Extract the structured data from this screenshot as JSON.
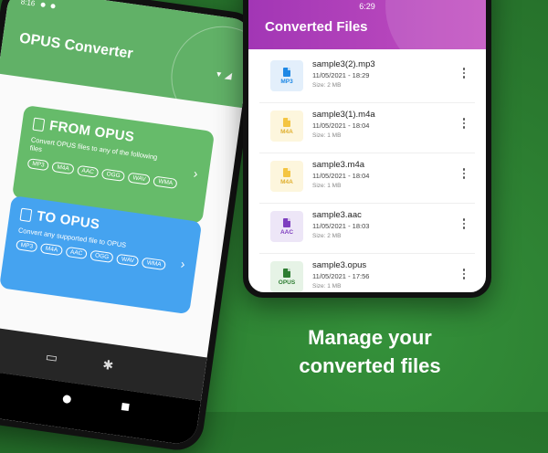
{
  "left_phone": {
    "status_time": "8:16",
    "app_title": "OPUS Converter",
    "from_card": {
      "title": "FROM OPUS",
      "description": "Convert OPUS files to any of the following files",
      "formats": [
        "MP3",
        "M4A",
        "AAC",
        "OGG",
        "WAV",
        "WMA"
      ]
    },
    "to_card": {
      "title": "TO OPUS",
      "description": "Convert any supported file to OPUS",
      "formats": [
        "MP3",
        "M4A",
        "AAC",
        "OGG",
        "WAV",
        "WMA"
      ]
    }
  },
  "right_phone": {
    "status_time": "6:29",
    "screen_title": "Converted Files",
    "files": [
      {
        "name": "sample3(2).mp3",
        "date": "11/05/2021 - 18:29",
        "size": "Size: 2 MB",
        "ext": "MP3",
        "icon_bg": "#e3effb",
        "icon_color": "#1e88e5"
      },
      {
        "name": "sample3(1).m4a",
        "date": "11/05/2021 - 18:04",
        "size": "Size: 1 MB",
        "ext": "M4A",
        "icon_bg": "#fdf6dd",
        "icon_color": "#f4c542"
      },
      {
        "name": "sample3.m4a",
        "date": "11/05/2021 - 18:04",
        "size": "Size: 1 MB",
        "ext": "M4A",
        "icon_bg": "#fdf6dd",
        "icon_color": "#f4c542"
      },
      {
        "name": "sample3.aac",
        "date": "11/05/2021 - 18:03",
        "size": "Size: 2 MB",
        "ext": "AAC",
        "icon_bg": "#ede6f7",
        "icon_color": "#7e3fbf"
      },
      {
        "name": "sample3.opus",
        "date": "11/05/2021 - 17:56",
        "size": "Size: 1 MB",
        "ext": "OPUS",
        "icon_bg": "#e6f3e6",
        "icon_color": "#2e7d32"
      }
    ]
  },
  "caption": {
    "line1": "Manage your",
    "line2": "converted files"
  },
  "colors": {
    "background": "#2a7a2f",
    "left_header": "#61b167",
    "from_card": "#66bb6a",
    "to_card": "#45a3f0",
    "right_header": "#b140bb"
  }
}
